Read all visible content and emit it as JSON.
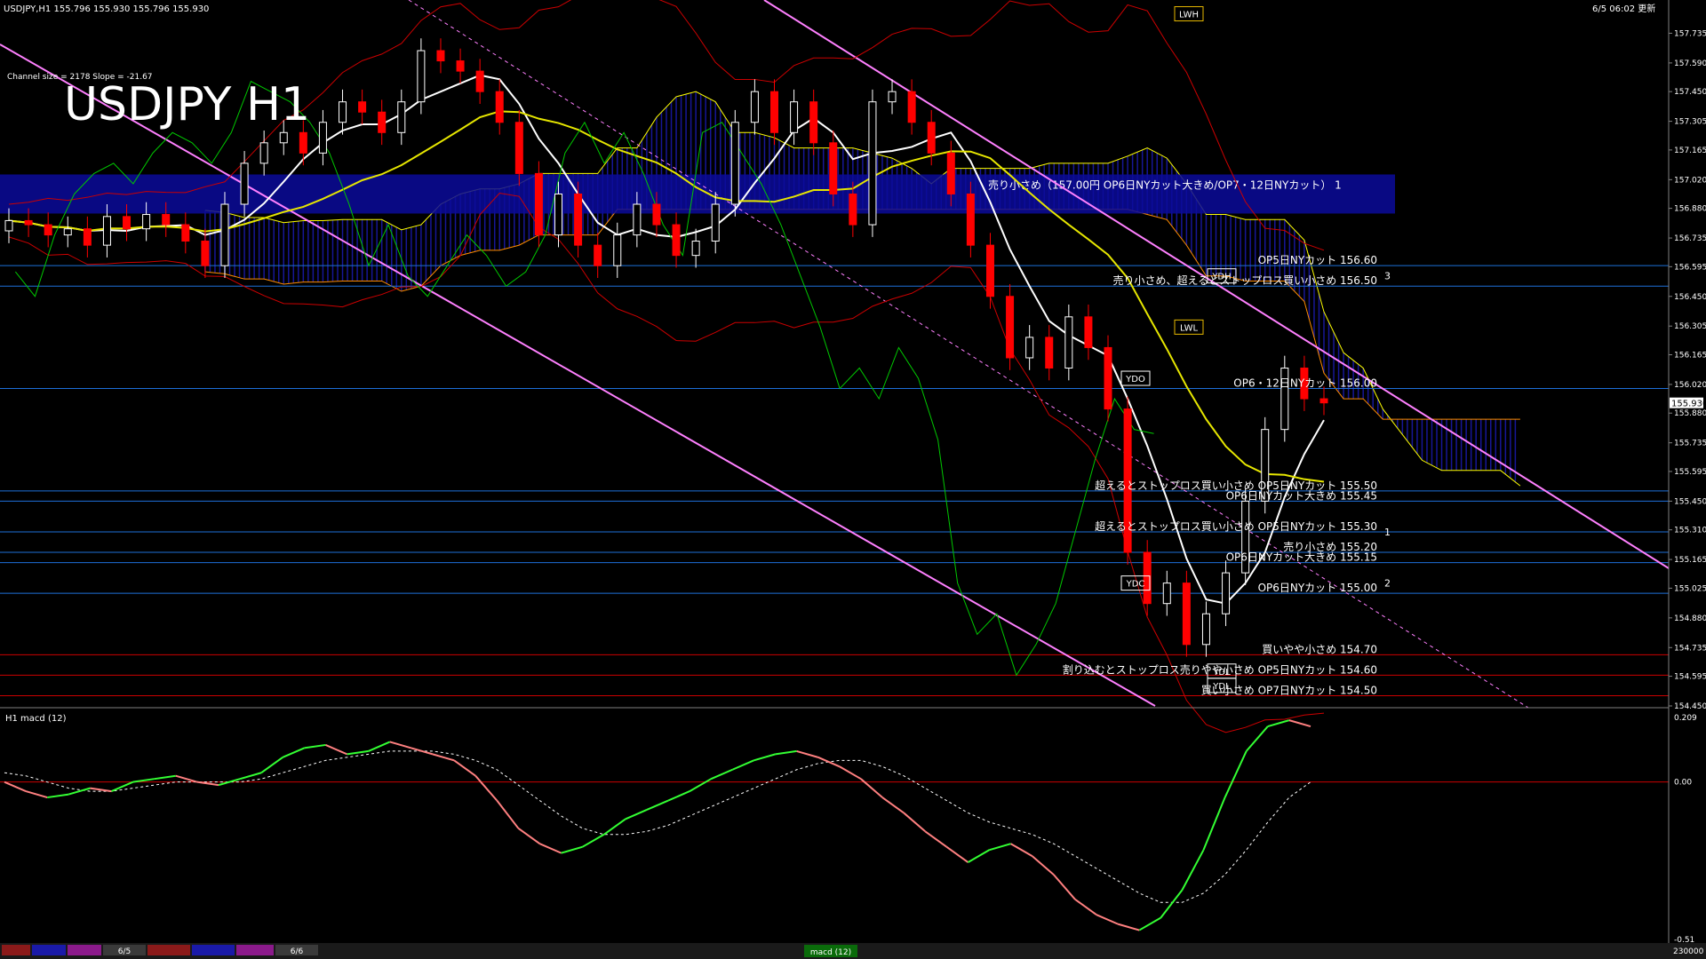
{
  "header": {
    "symbol_line": "USDJPY,H1 155.796 155.930 155.796 155.930",
    "updated": "6/5 06:02 更新",
    "big_title": "USDJPY H1",
    "channel_info": "Channel size = 2178 Slope = -21.67"
  },
  "colors": {
    "background": "#000000",
    "candle_up": "#ffffff",
    "candle_down": "#ff0000",
    "cloud": "#1a1aa8",
    "cloud_line": "#ffff00",
    "chikou": "#00c800",
    "sma_white": "#ffffff",
    "sma_yellow": "#e6e600",
    "bollinger": "#cc0000",
    "channel": "#ff80ff",
    "level_blue": "#1e6fd9",
    "level_red": "#cc0000",
    "macd_up": "#33ff33",
    "macd_down": "#ff8080",
    "signal": "#ffffff"
  },
  "chart_data": [
    {
      "type": "line",
      "title": "USDJPY H1",
      "ylim": [
        154.45,
        157.88
      ],
      "price_axis": [
        "157.735",
        "157.590",
        "157.450",
        "157.305",
        "157.165",
        "157.020",
        "156.880",
        "156.735",
        "156.595",
        "156.450",
        "156.305",
        "156.165",
        "156.020",
        "155.880",
        "155.735",
        "155.595",
        "155.450",
        "155.310",
        "155.165",
        "155.025",
        "154.880",
        "154.735",
        "154.595",
        "154.450"
      ],
      "current_price": "155.930",
      "close_series": [
        156.82,
        156.8,
        156.75,
        156.78,
        156.7,
        156.84,
        156.78,
        156.85,
        156.8,
        156.72,
        156.6,
        156.9,
        157.1,
        157.2,
        157.25,
        157.15,
        157.3,
        157.4,
        157.35,
        157.25,
        157.4,
        157.65,
        157.6,
        157.55,
        157.45,
        157.3,
        157.05,
        156.75,
        156.95,
        156.7,
        156.6,
        156.75,
        156.9,
        156.8,
        156.65,
        156.72,
        156.9,
        157.3,
        157.45,
        157.25,
        157.4,
        157.2,
        156.95,
        156.8,
        157.4,
        157.45,
        157.3,
        157.15,
        156.95,
        156.7,
        156.45,
        156.15,
        156.25,
        156.1,
        156.35,
        156.2,
        155.9,
        155.2,
        154.95,
        155.05,
        154.75,
        154.9,
        155.1,
        155.45,
        155.8,
        156.1,
        155.95,
        155.93
      ],
      "horizontal_levels": [
        {
          "price": 156.6,
          "label": "OP5日NYカット 156.60",
          "color": "blue"
        },
        {
          "price": 156.5,
          "label": "売り小さめ、超えるとストップロス買い小さめ 156.50",
          "color": "blue"
        },
        {
          "price": 156.0,
          "label": "OP6・12日NYカット 156.00",
          "color": "blue"
        },
        {
          "price": 155.5,
          "label": "超えるとストップロス買い小さめ OP5日NYカット 155.50",
          "color": "blue"
        },
        {
          "price": 155.45,
          "label": "OP6日NYカット大きめ 155.45",
          "color": "blue"
        },
        {
          "price": 155.3,
          "label": "超えるとストップロス買い小さめ OP5日NYカット 155.30",
          "color": "blue"
        },
        {
          "price": 155.2,
          "label": "売り小さめ 155.20",
          "color": "blue"
        },
        {
          "price": 155.15,
          "label": "OP6日NYカット大きめ 155.15",
          "color": "blue"
        },
        {
          "price": 155.0,
          "label": "OP6日NYカット 155.00",
          "color": "blue"
        },
        {
          "price": 154.7,
          "label": "買いやや小さめ 154.70",
          "color": "red"
        },
        {
          "price": 154.6,
          "label": "割り込むとストップロス売りやや小さめ OP5日NYカット 154.60",
          "color": "red"
        },
        {
          "price": 154.5,
          "label": "買い小さめ OP7日NYカット 154.50",
          "color": "red"
        }
      ],
      "zone_label": "売り小さめ（157.00円 OP6日NYカット大きめ/OP7・12日NYカット） 1",
      "zone_price": 156.95,
      "markers": [
        "YDO",
        "YDC",
        "YDH",
        "YDL",
        "LWH",
        "LWL",
        "YDL"
      ],
      "number_labels": [
        "3",
        "1",
        "2"
      ],
      "grid": false
    },
    {
      "type": "line",
      "title": "H1 macd (12)",
      "ylim": [
        -0.51,
        0.209
      ],
      "axis_labels": [
        "0.209",
        "0.00",
        "-0.51"
      ],
      "macd": [
        0.0,
        -0.03,
        -0.05,
        -0.04,
        -0.02,
        -0.03,
        0.0,
        0.01,
        0.02,
        0.0,
        -0.01,
        0.01,
        0.03,
        0.08,
        0.11,
        0.12,
        0.09,
        0.1,
        0.13,
        0.11,
        0.09,
        0.07,
        0.02,
        -0.06,
        -0.15,
        -0.2,
        -0.23,
        -0.21,
        -0.17,
        -0.12,
        -0.09,
        -0.06,
        -0.03,
        0.01,
        0.04,
        0.07,
        0.09,
        0.1,
        0.08,
        0.05,
        0.01,
        -0.05,
        -0.1,
        -0.16,
        -0.21,
        -0.26,
        -0.22,
        -0.2,
        -0.24,
        -0.3,
        -0.38,
        -0.43,
        -0.46,
        -0.48,
        -0.44,
        -0.35,
        -0.22,
        -0.05,
        0.1,
        0.18,
        0.2,
        0.18
      ],
      "signal": [
        0.03,
        0.02,
        0.0,
        -0.02,
        -0.03,
        -0.03,
        -0.02,
        -0.01,
        0.0,
        0.0,
        0.0,
        0.0,
        0.01,
        0.03,
        0.05,
        0.07,
        0.08,
        0.09,
        0.1,
        0.1,
        0.1,
        0.09,
        0.07,
        0.04,
        -0.01,
        -0.06,
        -0.11,
        -0.15,
        -0.17,
        -0.17,
        -0.16,
        -0.14,
        -0.11,
        -0.08,
        -0.05,
        -0.02,
        0.01,
        0.04,
        0.06,
        0.07,
        0.07,
        0.05,
        0.02,
        -0.02,
        -0.06,
        -0.1,
        -0.13,
        -0.15,
        -0.17,
        -0.2,
        -0.24,
        -0.28,
        -0.32,
        -0.36,
        -0.39,
        -0.39,
        -0.36,
        -0.3,
        -0.22,
        -0.13,
        -0.05,
        0.0
      ]
    }
  ],
  "footer": {
    "tab_date_1": "6/5",
    "tab_date_2": "6/6",
    "macd_tab": "macd (12)",
    "volume_label": "230000"
  }
}
